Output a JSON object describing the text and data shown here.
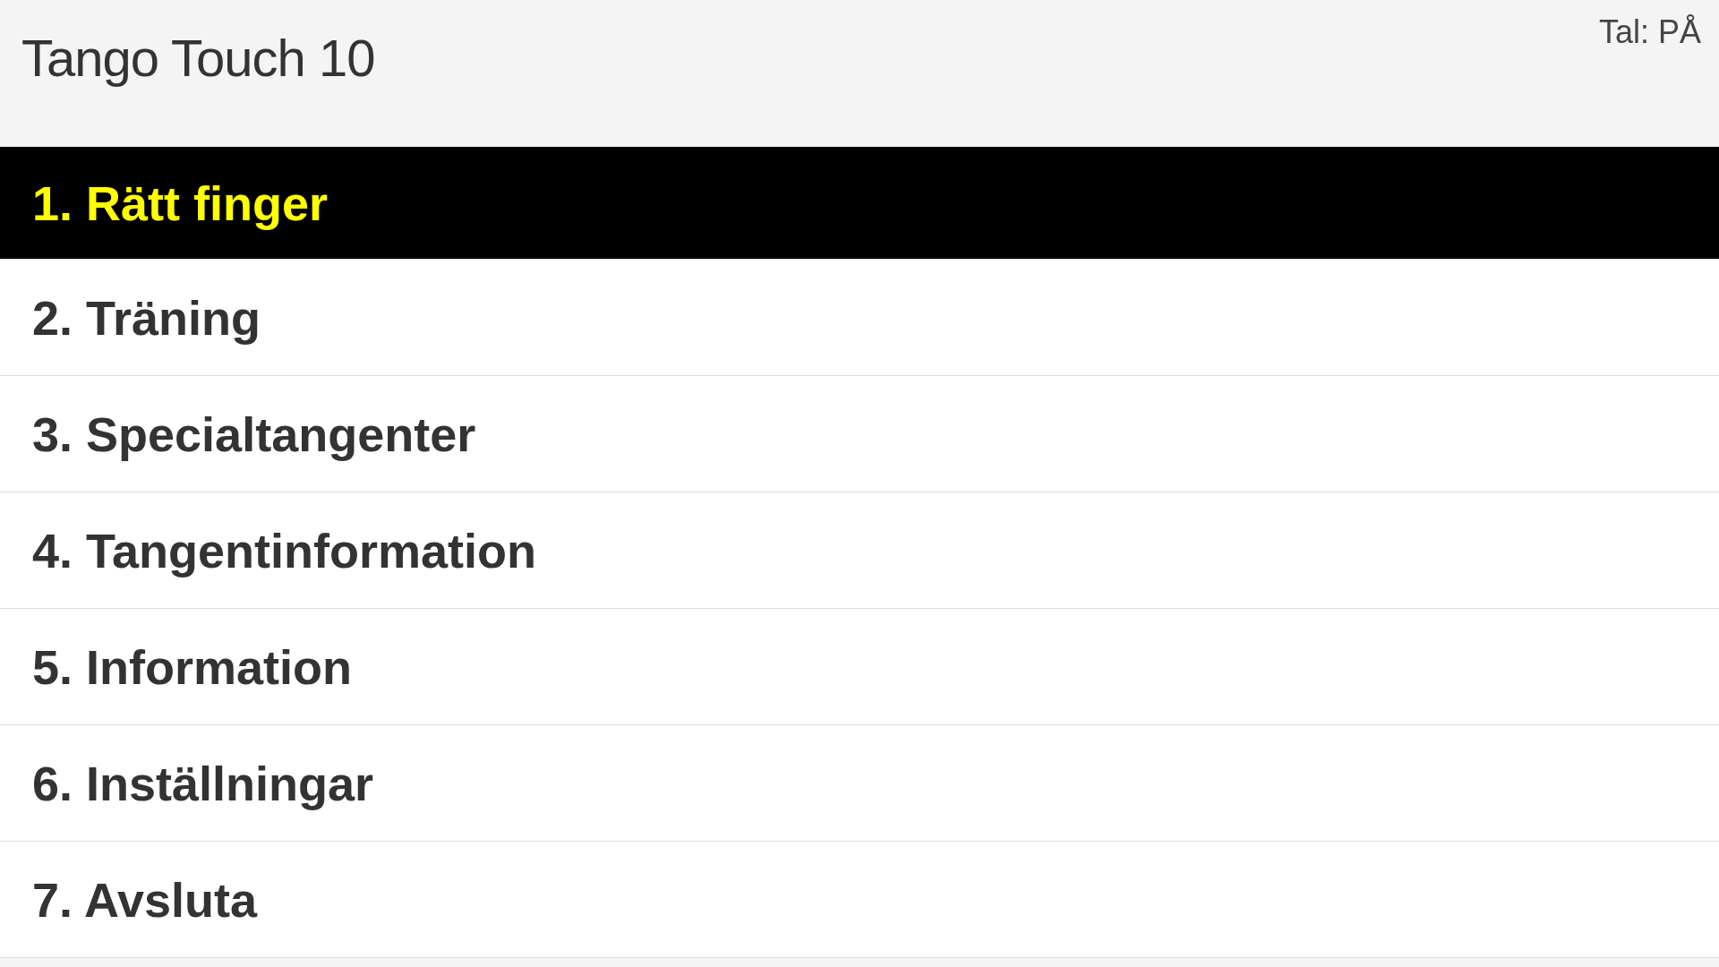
{
  "header": {
    "title": "Tango Touch 10",
    "speech_status": "Tal: PÅ"
  },
  "menu": {
    "items": [
      {
        "label": "1. Rätt finger",
        "selected": true
      },
      {
        "label": "2. Träning",
        "selected": false
      },
      {
        "label": "3. Specialtangenter",
        "selected": false
      },
      {
        "label": "4. Tangentinformation",
        "selected": false
      },
      {
        "label": "5. Information",
        "selected": false
      },
      {
        "label": "6. Inställningar",
        "selected": false
      },
      {
        "label": "7. Avsluta",
        "selected": false
      }
    ]
  }
}
